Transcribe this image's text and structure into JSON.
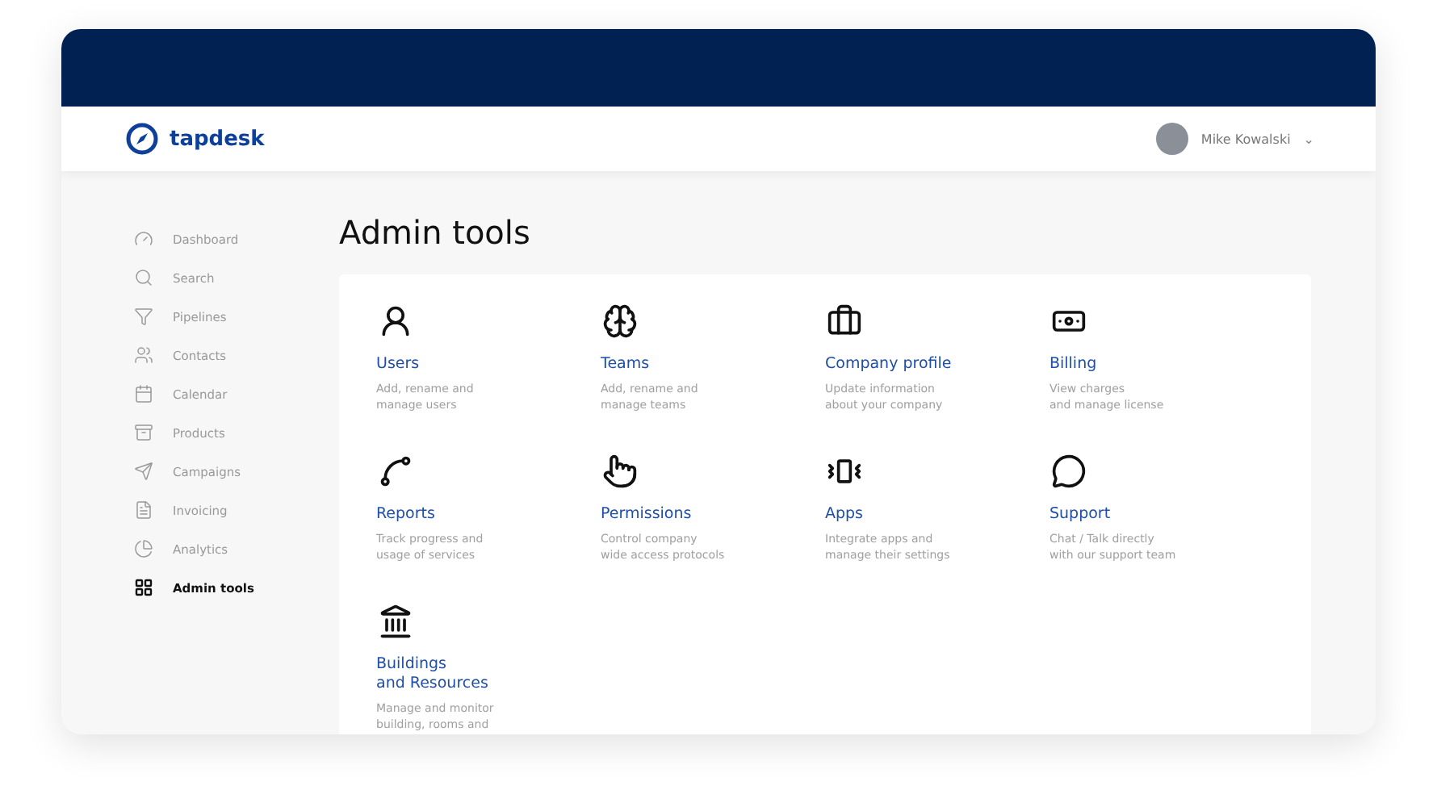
{
  "brand": {
    "name": "tapdesk"
  },
  "user": {
    "name": "Mike Kowalski",
    "caret": "⌄"
  },
  "sidebar": {
    "items": [
      {
        "label": "Dashboard",
        "selected": false
      },
      {
        "label": "Search",
        "selected": false
      },
      {
        "label": "Pipelines",
        "selected": false
      },
      {
        "label": "Contacts",
        "selected": false
      },
      {
        "label": "Calendar",
        "selected": false
      },
      {
        "label": "Products",
        "selected": false
      },
      {
        "label": "Campaigns",
        "selected": false
      },
      {
        "label": "Invoicing",
        "selected": false
      },
      {
        "label": "Analytics",
        "selected": false
      },
      {
        "label": "Admin tools",
        "selected": true
      }
    ]
  },
  "page": {
    "title": "Admin tools"
  },
  "tools": [
    {
      "title": "Users",
      "description": "Add, rename and\nmanage users"
    },
    {
      "title": "Teams",
      "description": "Add, rename and\nmanage teams"
    },
    {
      "title": "Company profile",
      "description": "Update information\nabout your company"
    },
    {
      "title": "Billing",
      "description": "View charges\nand manage license"
    },
    {
      "title": "Reports",
      "description": "Track progress and\nusage of services"
    },
    {
      "title": "Permissions",
      "description": "Control company\nwide access protocols"
    },
    {
      "title": "Apps",
      "description": "Integrate apps and\nmanage their settings"
    },
    {
      "title": "Support",
      "description": "Chat / Talk directly\nwith our support team"
    },
    {
      "title": "Buildings\nand Resources",
      "description": "Manage and monitor\nbuilding, rooms and"
    }
  ]
}
